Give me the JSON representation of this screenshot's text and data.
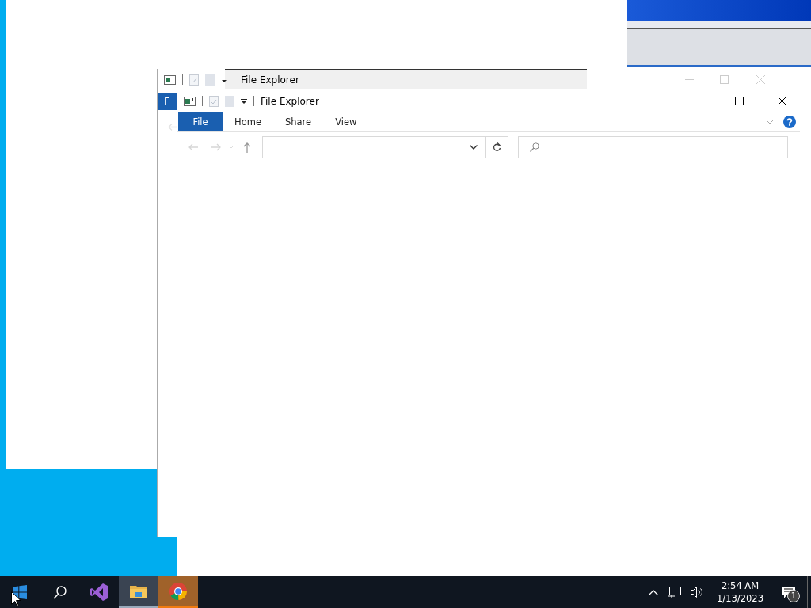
{
  "back_window": {
    "title": "File Explorer",
    "ribbon_tabs": [
      {
        "label": "F",
        "selected": true
      }
    ]
  },
  "window": {
    "title": "File Explorer",
    "ribbon_tabs": [
      {
        "label": "File",
        "selected": true
      },
      {
        "label": "Home",
        "selected": false
      },
      {
        "label": "Share",
        "selected": false
      },
      {
        "label": "View",
        "selected": false
      }
    ]
  },
  "taskbar": {
    "apps": [
      {
        "kind": "start",
        "active": false,
        "flashing": false
      },
      {
        "kind": "search",
        "active": false,
        "flashing": false
      },
      {
        "kind": "visual-studio",
        "active": false,
        "flashing": false
      },
      {
        "kind": "folder",
        "active": true,
        "flashing": false
      },
      {
        "kind": "chrome",
        "active": false,
        "flashing": true
      }
    ],
    "time": "2:54 AM",
    "date": "1/13/2023",
    "notification_count": "1"
  }
}
